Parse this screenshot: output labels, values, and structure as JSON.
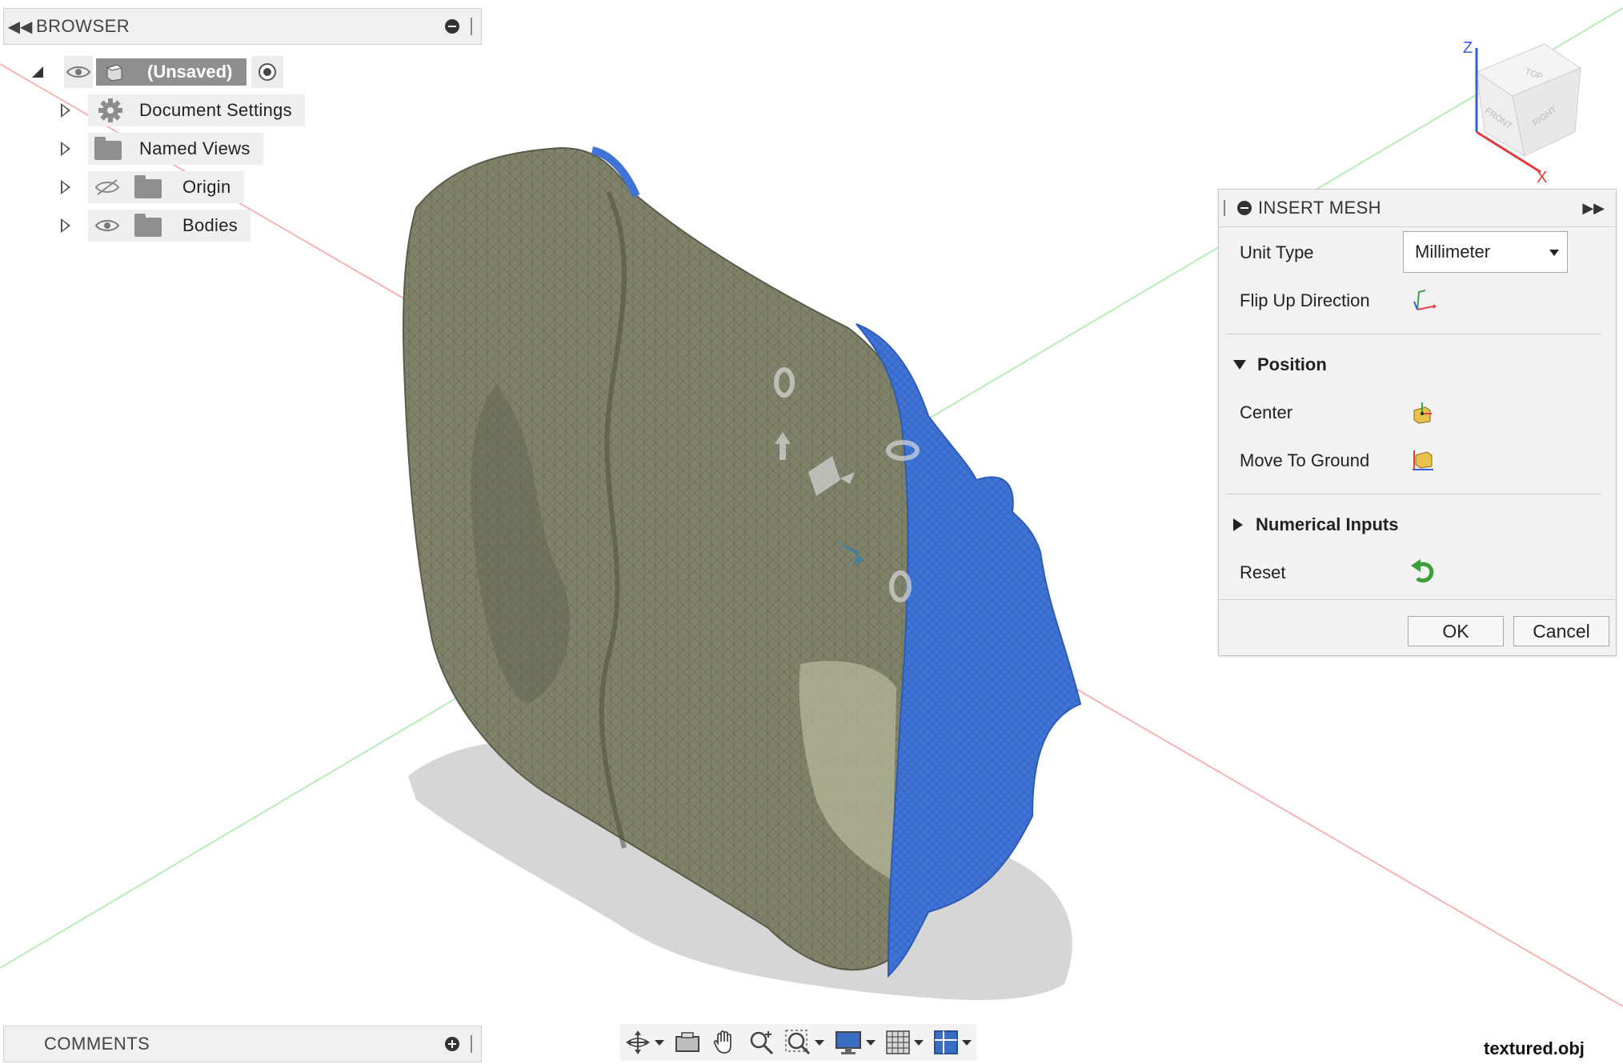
{
  "browser": {
    "title": "BROWSER",
    "root": {
      "label": "(Unsaved)"
    },
    "items": [
      {
        "label": "Document Settings",
        "icon": "gear-icon"
      },
      {
        "label": "Named Views",
        "icon": "folder-icon"
      },
      {
        "label": "Origin",
        "icon": "folder-icon",
        "visibility": "hidden"
      },
      {
        "label": "Bodies",
        "icon": "folder-icon",
        "visibility": "visible"
      }
    ]
  },
  "comments": {
    "title": "COMMENTS"
  },
  "viewcube": {
    "faces": {
      "top": "TOP",
      "front": "FRONT",
      "right": "RIGHT"
    },
    "axes": {
      "z": "Z",
      "x": "X"
    }
  },
  "insert_mesh": {
    "title": "INSERT MESH",
    "unit_type_label": "Unit Type",
    "unit_type_value": "Millimeter",
    "flip_up_label": "Flip Up Direction",
    "position_section": "Position",
    "center_label": "Center",
    "move_to_ground_label": "Move To Ground",
    "numerical_inputs_section": "Numerical Inputs",
    "reset_label": "Reset",
    "ok_label": "OK",
    "cancel_label": "Cancel"
  },
  "toolbar": {
    "tools": [
      "orbit-icon",
      "look-at-icon",
      "pan-icon",
      "zoom-icon",
      "fit-icon",
      "display-settings-icon",
      "grid-icon",
      "viewports-icon"
    ]
  },
  "status": {
    "filename": "textured.obj"
  },
  "colors": {
    "mesh": "#7a7d62",
    "mesh_selected": "#3f73d6",
    "x_axis": "#f2a3a3",
    "y_axis": "#a9e6a9"
  }
}
